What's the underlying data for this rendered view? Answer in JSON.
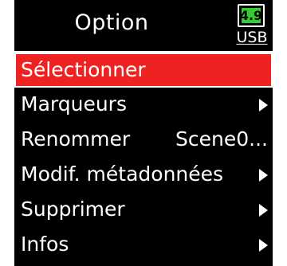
{
  "header": {
    "title": "Option",
    "battery_level": "4.9",
    "power_source": "USB",
    "battery_color": "#33cc33"
  },
  "menu": {
    "items": [
      {
        "label": "Sélectionner",
        "selected": true,
        "has_submenu": false
      },
      {
        "label": "Marqueurs",
        "selected": false,
        "has_submenu": true
      },
      {
        "label": "Renommer",
        "value": "Scene0...",
        "selected": false,
        "has_submenu": false
      },
      {
        "label": "Modif. métadonnées",
        "selected": false,
        "has_submenu": true
      },
      {
        "label": "Supprimer",
        "selected": false,
        "has_submenu": true
      },
      {
        "label": "Infos",
        "selected": false,
        "has_submenu": true
      }
    ]
  },
  "colors": {
    "background": "#000000",
    "highlight": "#ef2222",
    "text": "#ffffff"
  },
  "icons": {
    "submenu": "triangle-right-icon",
    "battery": "battery-icon"
  }
}
